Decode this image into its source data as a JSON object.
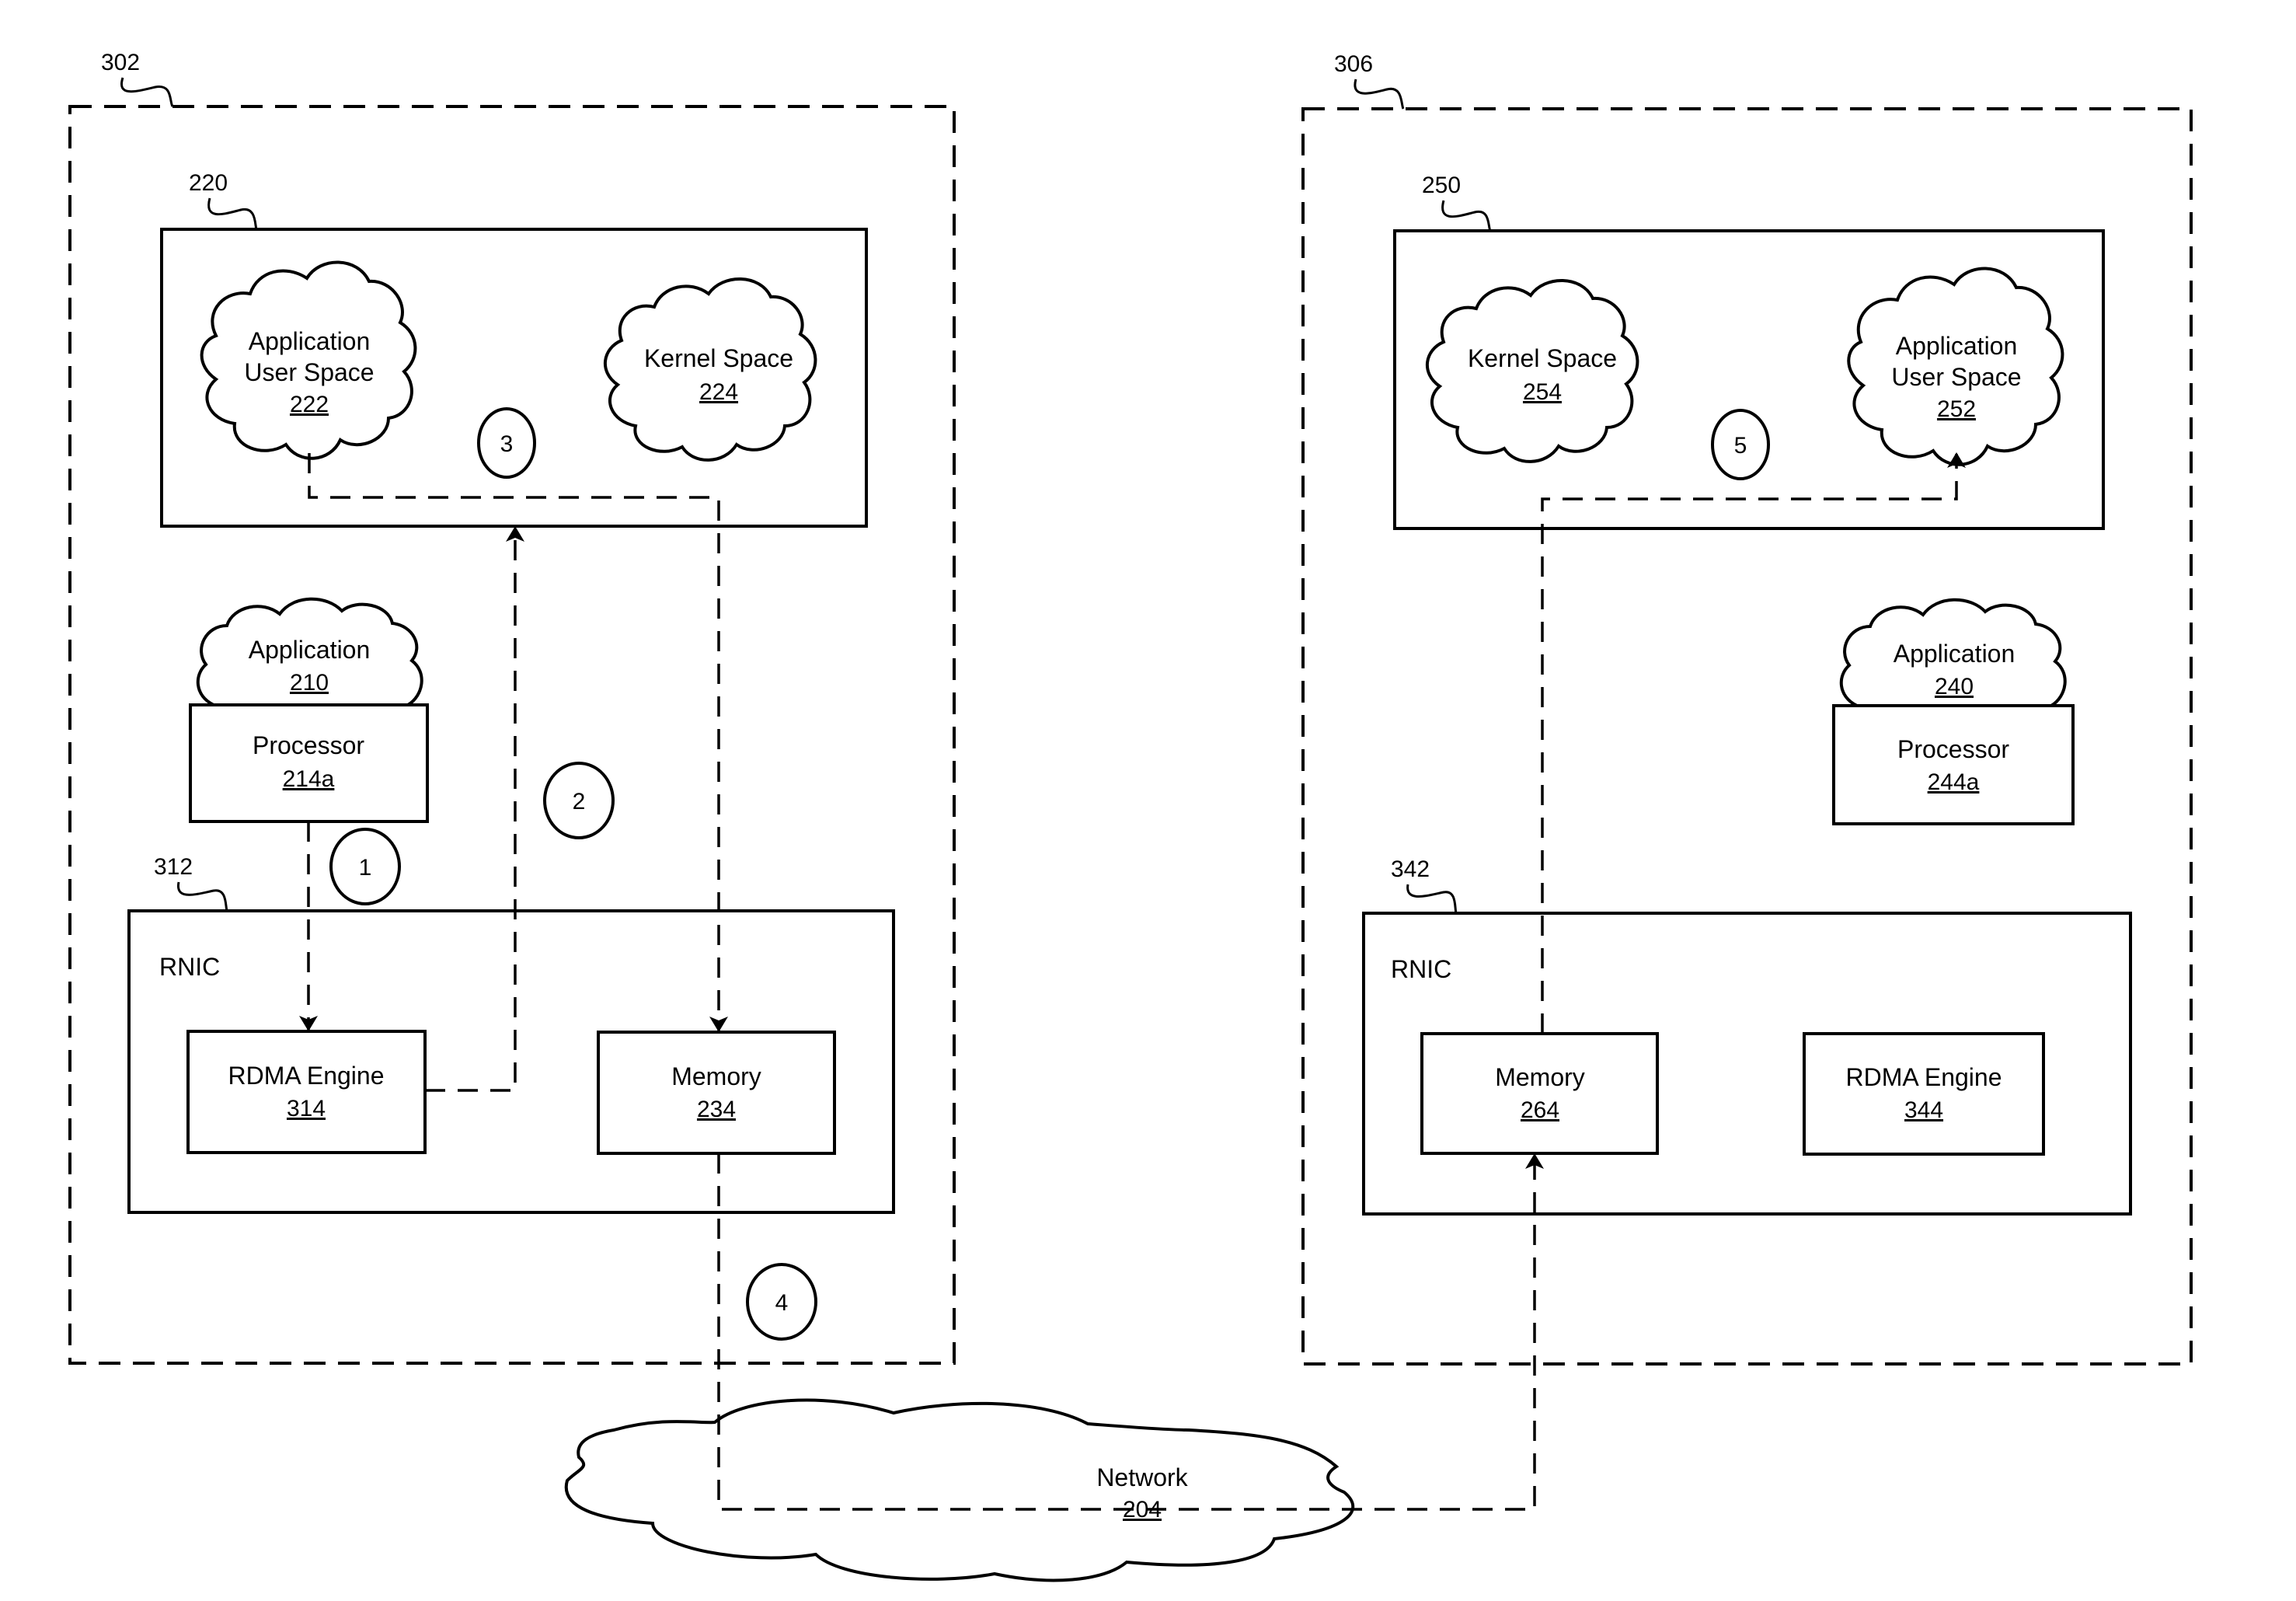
{
  "figure": {
    "hosts": [
      {
        "ref": "302",
        "subsystem": {
          "ref": "220",
          "clouds": [
            {
              "lines": [
                "Application",
                "User Space"
              ],
              "ref": "222"
            },
            {
              "lines": [
                "Kernel Space"
              ],
              "ref": "224"
            }
          ],
          "step": "3"
        },
        "application": {
          "lines": [
            "Application"
          ],
          "ref": "210"
        },
        "processor": {
          "label": "Processor",
          "ref": "214a"
        },
        "rnic": {
          "ref": "312",
          "label": "RNIC",
          "left": {
            "label": "RDMA Engine",
            "ref": "314"
          },
          "right": {
            "label": "Memory",
            "ref": "234"
          }
        },
        "steps": [
          "1",
          "2",
          "4"
        ]
      },
      {
        "ref": "306",
        "subsystem": {
          "ref": "250",
          "clouds": [
            {
              "lines": [
                "Kernel Space"
              ],
              "ref": "254"
            },
            {
              "lines": [
                "Application",
                "User Space"
              ],
              "ref": "252"
            }
          ],
          "step": "5"
        },
        "application": {
          "lines": [
            "Application"
          ],
          "ref": "240"
        },
        "processor": {
          "label": "Processor",
          "ref": "244a"
        },
        "rnic": {
          "ref": "342",
          "label": "RNIC",
          "left": {
            "label": "Memory",
            "ref": "264"
          },
          "right": {
            "label": "RDMA Engine",
            "ref": "344"
          }
        }
      }
    ],
    "network": {
      "label": "Network",
      "ref": "204"
    },
    "line_color": "#000000",
    "background": "#ffffff"
  }
}
